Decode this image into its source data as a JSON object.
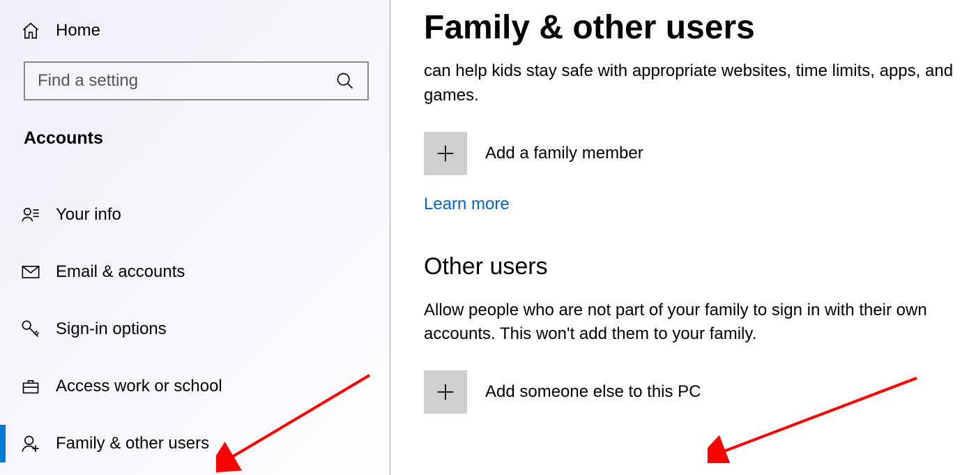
{
  "sidebar": {
    "home_label": "Home",
    "search_placeholder": "Find a setting",
    "category": "Accounts",
    "items": [
      {
        "label": "Your info"
      },
      {
        "label": "Email & accounts"
      },
      {
        "label": "Sign-in options"
      },
      {
        "label": "Access work or school"
      },
      {
        "label": "Family & other users"
      }
    ]
  },
  "main": {
    "title": "Family & other users",
    "family_desc": "can help kids stay safe with appropriate websites, time limits, apps, and games.",
    "add_family_label": "Add a family member",
    "learn_more": "Learn more",
    "other_users_heading": "Other users",
    "other_users_desc": "Allow people who are not part of your family to sign in with their own accounts. This won't add them to your family.",
    "add_other_label": "Add someone else to this PC"
  }
}
